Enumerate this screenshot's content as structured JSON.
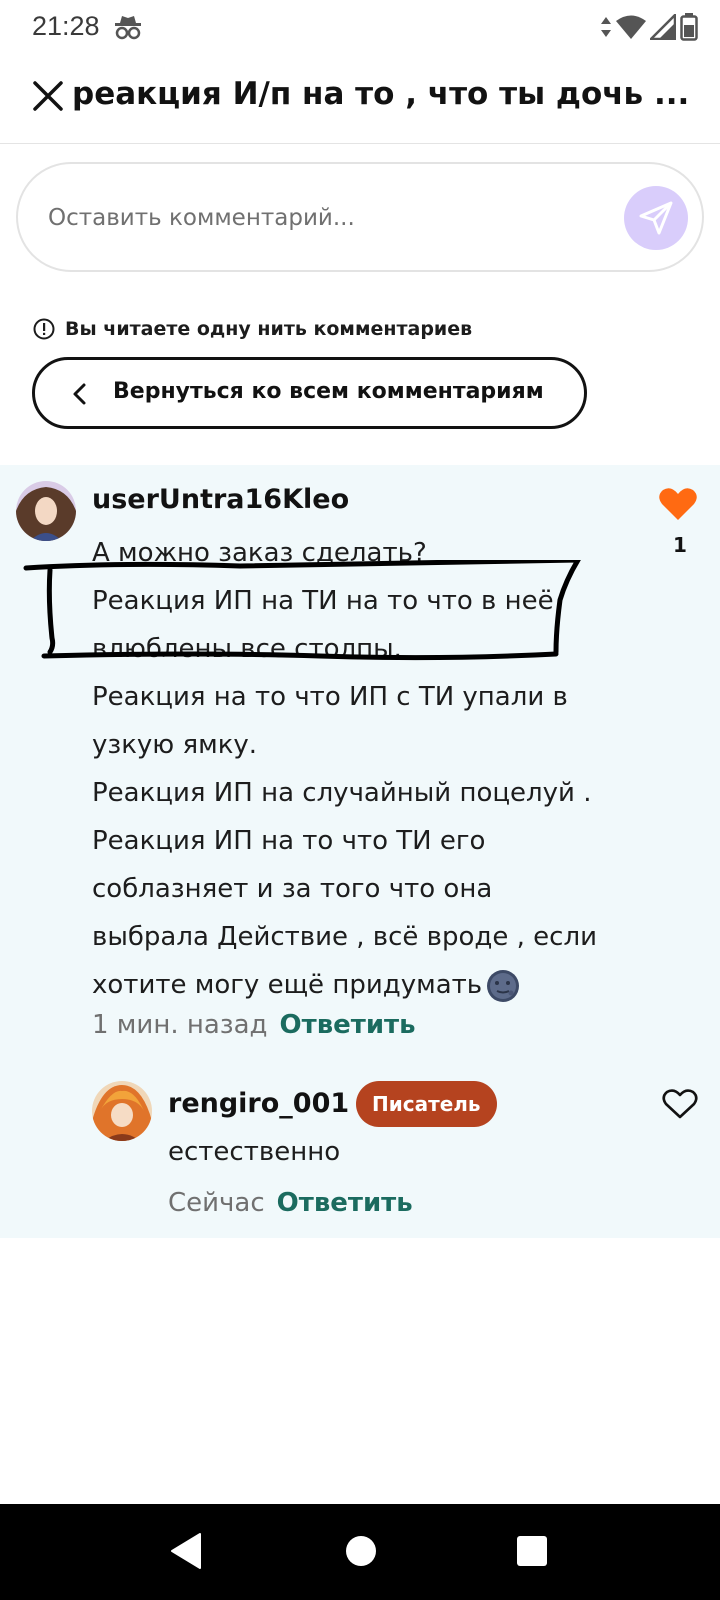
{
  "status_bar": {
    "time": "21:28"
  },
  "header": {
    "title": "реакция И/п на то , что ты дочь ..."
  },
  "composer": {
    "placeholder": "Оставить комментарий..."
  },
  "thread_notice": {
    "text": "Вы читаете одну нить комментариев"
  },
  "back_button": {
    "label": "Вернуться ко всем комментариям"
  },
  "comments": [
    {
      "username": "userUntra16Kleo",
      "lines": [
        "А можно заказ сделать?",
        "Реакция ИП на ТИ на то что в неё",
        "влюблены все столпы.",
        "Реакция на то что ИП с ТИ упали в",
        "узкую ямку.",
        "Реакция ИП на случайный поцелуй .",
        "Реакция ИП на то что ТИ его",
        "соблазняет и за того что она",
        "выбрала Действие , всё вроде , если",
        "хотите могу ещё придумать"
      ],
      "time": "1 мин. назад",
      "reply_label": "Ответить",
      "likes": "1",
      "liked": true
    },
    {
      "username": "rengiro_001",
      "badge": "Писатель",
      "text": "естественно",
      "time": "Сейчас",
      "reply_label": "Ответить",
      "liked": false
    }
  ],
  "colors": {
    "accent_like": "#ff6a12",
    "reply_link": "#1b6b5f",
    "badge": "#b5431f",
    "send_button": "#d9cdfb",
    "thread_bg": "#f1f9fb"
  }
}
